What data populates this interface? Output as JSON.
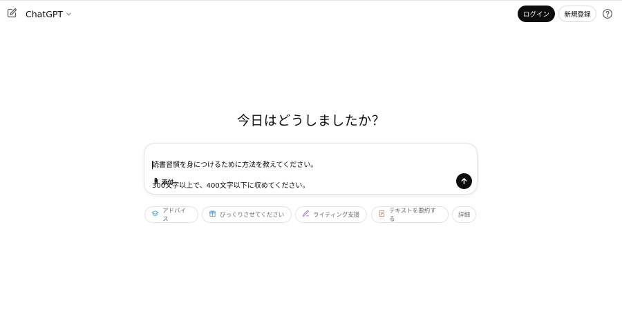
{
  "header": {
    "model_name": "ChatGPT",
    "login_label": "ログイン",
    "signup_label": "新規登録"
  },
  "main": {
    "headline": "今日はどうしましたか？"
  },
  "composer": {
    "line1": "読書習慣を身につけるために方法を教えてください。",
    "line2": "300文字以上で、400文字以下に収めてください。",
    "attach_label": "添付"
  },
  "suggestions": [
    {
      "label": "アドバイス",
      "icon": "graduation-cap-icon",
      "color": "#4fb3e6"
    },
    {
      "label": "びっくりさせてください",
      "icon": "gift-icon",
      "color": "#5aa9e6"
    },
    {
      "label": "ライティング支援",
      "icon": "pen-icon",
      "color": "#b57ae0"
    },
    {
      "label": "テキストを要約する",
      "icon": "document-icon",
      "color": "#ef8a3b"
    },
    {
      "label": "詳細",
      "icon": "",
      "color": ""
    }
  ],
  "colors": {
    "primary_button": "#0d0d0d",
    "border": "#e3e3e3",
    "muted_text": "#6b6b6b"
  }
}
